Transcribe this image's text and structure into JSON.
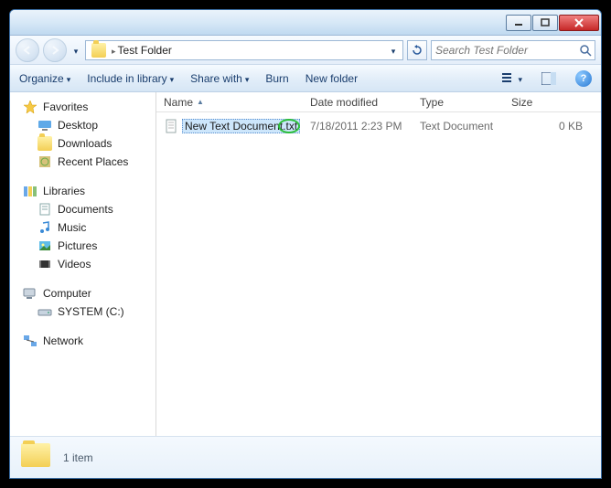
{
  "titlebar": {},
  "addressbar": {
    "folder": "Test Folder"
  },
  "search": {
    "placeholder": "Search Test Folder"
  },
  "toolbar": {
    "organize": "Organize",
    "include": "Include in library",
    "share": "Share with",
    "burn": "Burn",
    "newfolder": "New folder"
  },
  "sidebar": {
    "favorites": {
      "label": "Favorites",
      "items": [
        "Desktop",
        "Downloads",
        "Recent Places"
      ]
    },
    "libraries": {
      "label": "Libraries",
      "items": [
        "Documents",
        "Music",
        "Pictures",
        "Videos"
      ]
    },
    "computer": {
      "label": "Computer",
      "items": [
        "SYSTEM (C:)"
      ]
    },
    "network": {
      "label": "Network"
    }
  },
  "columns": {
    "name": "Name",
    "date": "Date modified",
    "type": "Type",
    "size": "Size"
  },
  "files": [
    {
      "name": "New Text Document.txt",
      "date": "7/18/2011 2:23 PM",
      "type": "Text Document",
      "size": "0 KB"
    }
  ],
  "status": {
    "text": "1 item"
  }
}
